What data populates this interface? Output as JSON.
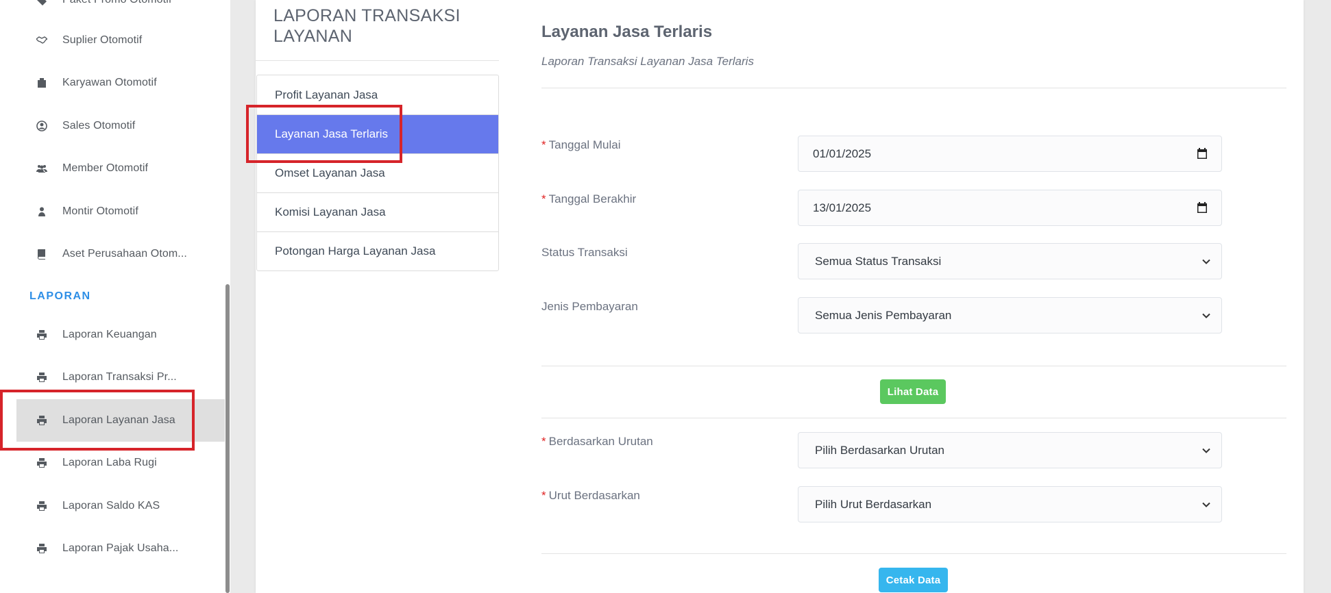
{
  "sidebar": {
    "items_top": [
      {
        "label": "Paket Promo Otomotif",
        "icon": "tag-icon"
      },
      {
        "label": "Suplier Otomotif",
        "icon": "handshake-icon"
      },
      {
        "label": "Karyawan Otomotif",
        "icon": "briefcase-icon"
      },
      {
        "label": "Sales Otomotif",
        "icon": "user-circle-icon"
      },
      {
        "label": "Member Otomotif",
        "icon": "users-icon"
      },
      {
        "label": "Montir Otomotif",
        "icon": "user-icon"
      },
      {
        "label": "Aset Perusahaan Otom...",
        "icon": "book-icon"
      }
    ],
    "section_label": "LAPORAN",
    "items_report": [
      {
        "label": "Laporan Keuangan",
        "icon": "print-icon"
      },
      {
        "label": "Laporan Transaksi Pr...",
        "icon": "print-icon"
      },
      {
        "label": "Laporan Layanan Jasa",
        "icon": "print-icon",
        "active": true
      },
      {
        "label": "Laporan Laba Rugi",
        "icon": "print-icon"
      },
      {
        "label": "Laporan Saldo KAS",
        "icon": "print-icon"
      },
      {
        "label": "Laporan Pajak Usaha...",
        "icon": "print-icon"
      }
    ]
  },
  "left_panel": {
    "title": "LAPORAN TRANSAKSI LAYANAN",
    "nav": [
      "Profit Layanan Jasa",
      "Layanan Jasa Terlaris",
      "Omset Layanan Jasa",
      "Komisi Layanan Jasa",
      "Potongan Harga Layanan Jasa"
    ],
    "active_nav": "Layanan Jasa Terlaris"
  },
  "form": {
    "title": "Layanan Jasa Terlaris",
    "subtitle": "Laporan Transaksi Layanan Jasa Terlaris",
    "required_mark": "*",
    "start_date": {
      "label": "Tanggal Mulai",
      "value": "01/01/2025"
    },
    "end_date": {
      "label": "Tanggal Berakhir",
      "value": "13/01/2025"
    },
    "status": {
      "label": "Status Transaksi",
      "value": "Semua Status Transaksi"
    },
    "payment": {
      "label": "Jenis Pembayaran",
      "value": "Semua Jenis Pembayaran"
    },
    "view_button": "Lihat Data",
    "sort_by": {
      "label": "Berdasarkan Urutan",
      "value": "Pilih Berdasarkan Urutan"
    },
    "order_by": {
      "label": "Urut Berdasarkan",
      "value": "Pilih Urut Berdasarkan"
    },
    "print_button": "Cetak Data"
  },
  "colors": {
    "accent": "#6679ec",
    "section": "#2d8ee6",
    "green_button": "#5bc85f",
    "blue_button": "#36b6ee",
    "highlight": "#d6242a"
  }
}
